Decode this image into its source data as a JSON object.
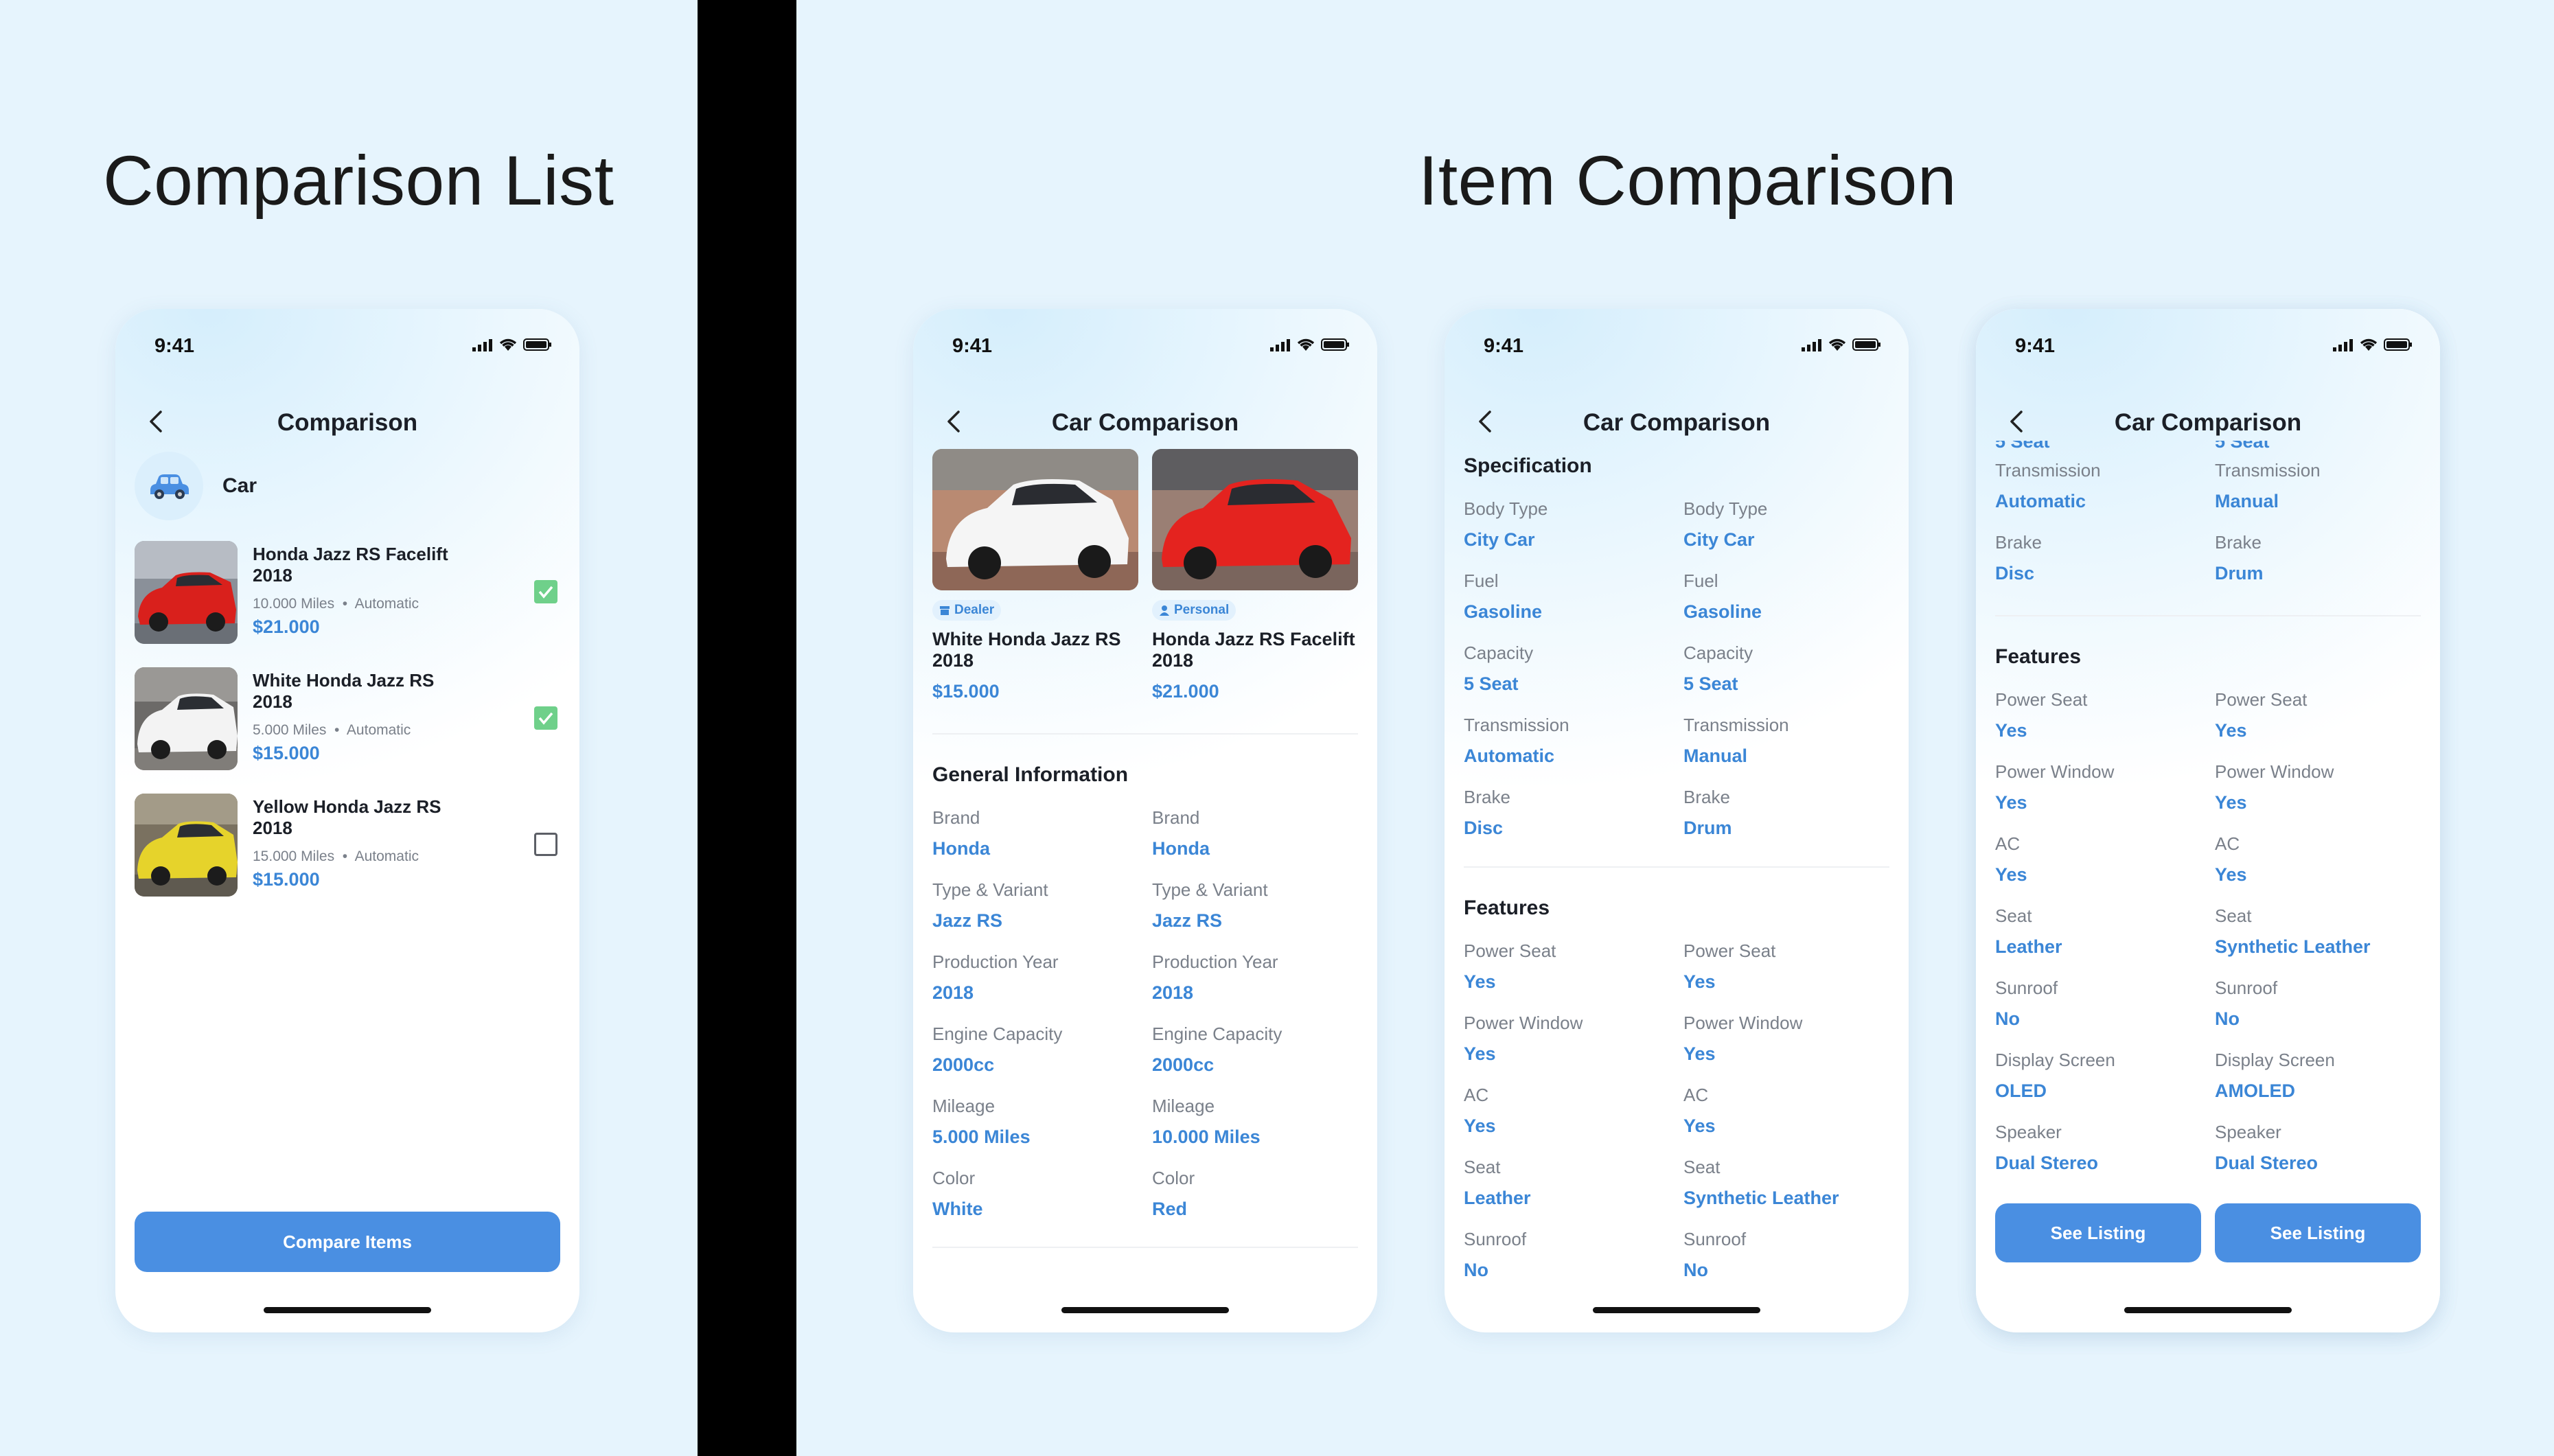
{
  "titles": {
    "left": "Comparison List",
    "right": "Item Comparison"
  },
  "status_time": "9:41",
  "list_screen": {
    "title": "Comparison",
    "category": "Car",
    "items": [
      {
        "name": "Honda Jazz RS Facelift 2018",
        "miles": "10.000 Miles",
        "trans": "Automatic",
        "price": "$21.000",
        "checked": true,
        "color": "red"
      },
      {
        "name": "White Honda Jazz RS 2018",
        "miles": "5.000 Miles",
        "trans": "Automatic",
        "price": "$15.000",
        "checked": true,
        "color": "white"
      },
      {
        "name": "Yellow Honda Jazz RS 2018",
        "miles": "15.000 Miles",
        "trans": "Automatic",
        "price": "$15.000",
        "checked": false,
        "color": "yellow"
      }
    ],
    "button": "Compare Items"
  },
  "compare": {
    "title": "Car Comparison",
    "cars": [
      {
        "badge": "Dealer",
        "name": "White Honda Jazz RS 2018",
        "price": "$15.000"
      },
      {
        "badge": "Personal",
        "name": "Honda Jazz RS Facelift 2018",
        "price": "$21.000"
      }
    ],
    "general_title": "General Information",
    "general": [
      {
        "label": "Brand",
        "a": "Honda",
        "b": "Honda"
      },
      {
        "label": "Type & Variant",
        "a": "Jazz RS",
        "b": "Jazz RS"
      },
      {
        "label": "Production Year",
        "a": "2018",
        "b": "2018"
      },
      {
        "label": "Engine Capacity",
        "a": "2000cc",
        "b": "2000cc"
      },
      {
        "label": "Mileage",
        "a": "5.000 Miles",
        "b": "10.000 Miles"
      },
      {
        "label": "Color",
        "a": "White",
        "b": "Red"
      }
    ],
    "spec_title": "Specification",
    "spec": [
      {
        "label": "Body Type",
        "a": "City Car",
        "b": "City Car"
      },
      {
        "label": "Fuel",
        "a": "Gasoline",
        "b": "Gasoline"
      },
      {
        "label": "Capacity",
        "a": "5 Seat",
        "b": "5 Seat"
      },
      {
        "label": "Transmission",
        "a": "Automatic",
        "b": "Manual"
      },
      {
        "label": "Brake",
        "a": "Disc",
        "b": "Drum"
      }
    ],
    "features_title": "Features",
    "features": [
      {
        "label": "Power Seat",
        "a": "Yes",
        "b": "Yes"
      },
      {
        "label": "Power Window",
        "a": "Yes",
        "b": "Yes"
      },
      {
        "label": "AC",
        "a": "Yes",
        "b": "Yes"
      },
      {
        "label": "Seat",
        "a": "Leather",
        "b": "Synthetic Leather"
      },
      {
        "label": "Sunroof",
        "a": "No",
        "b": "No"
      },
      {
        "label": "Display Screen",
        "a": "OLED",
        "b": "AMOLED"
      },
      {
        "label": "Speaker",
        "a": "Dual Stereo",
        "b": "Dual Stereo"
      }
    ],
    "see_listing": "See Listing"
  }
}
